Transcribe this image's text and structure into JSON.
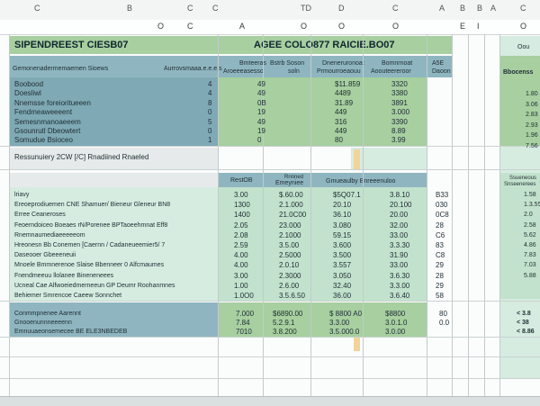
{
  "column_headers": [
    "C",
    "B",
    "C",
    "C",
    "TD",
    "D",
    "C",
    "A",
    "B",
    "B",
    "A",
    "C"
  ],
  "row2_headers": [
    "O",
    "C",
    "A",
    "O",
    "O",
    "O",
    "E",
    "I",
    "O"
  ],
  "title_left": "SIPENDREEST CIESB07",
  "title_right": "AGEE COLO877 RAICIE.BO07",
  "right_panel": {
    "small_label": "Oou",
    "header": "Bbocenss",
    "values": [
      "1.80",
      "3.06",
      "2.83",
      "2.93",
      "1.96",
      "7.56"
    ],
    "values_mid": [
      "1.58",
      "1.3.55",
      "2.0",
      "2.58",
      "5.62",
      "4.86",
      "7.83",
      "7.03",
      "5.88"
    ],
    "values_bottom": [
      "< 3.8",
      "< 38",
      "< 8.86"
    ]
  },
  "header_row": {
    "left": "Gemonenadermemaemen Sioews",
    "mid_left": "Aurrovsmaaa.e.e.e.s",
    "col1_top": "Bmteeras",
    "col1_bot": "Aroeeeasesso",
    "col2_top": "Bstrb Soson",
    "col2_bot": "soln",
    "col3_top": "Dneneruronoat",
    "col3_bot": "Prmourroeaouu",
    "col4_top": "Bomnrnoat",
    "col4_bot": "Aoouteereroor",
    "col5_top": "A5E",
    "col5_bot": "Daoon"
  },
  "top_rows": [
    {
      "label": "Boobood",
      "flag": "4",
      "c1": "49",
      "c2": "$11.859",
      "c3": "3320"
    },
    {
      "label": "Doesliwl",
      "flag": "4",
      "c1": "49",
      "c2": "4489",
      "c3": "3380"
    },
    {
      "label": "Nnemsse  foreioritueeen",
      "flag": "8",
      "c1": "0B",
      "c2": "31.89",
      "c3": "3891"
    },
    {
      "label": "Fendmeaweeeent",
      "flag": "0",
      "c1": "19",
      "c2": "449",
      "c3": "3.000"
    },
    {
      "label": "Semesnmanoaeeem",
      "flag": "5",
      "c1": "49",
      "c2": "316",
      "c3": "3390"
    },
    {
      "label": "Gsounrutl  Dbeowtert",
      "flag": "0",
      "c1": "19",
      "c2": "449",
      "c3": "8.89"
    },
    {
      "label": "Somudue  Bsioceo",
      "flag": "1",
      "c1": "0",
      "c2": "80",
      "c3": "3.99"
    }
  ],
  "note_row": "Ressunuiery  2CW  [/C]  Rnadiined  Rnaeled",
  "section2_header": {
    "c1": "RestOB",
    "c2_top": "Rnnned",
    "c2_bot": "Emeyniee",
    "c3": "Gmueaulby  Bnreeenuloo",
    "right": "Ssueneous",
    "right2": "Snseenerees"
  },
  "section2_rows": [
    {
      "label": "lriavy",
      "c1": "3.00",
      "c2": "$.60.00",
      "c3": "$5Q07.1",
      "c4": "3.8.10",
      "c5": "B33",
      "c6": "1.58"
    },
    {
      "label": "Ereoeprodiuemen  CNE  Shamuer/  Bieneur  Gleneur  BN8",
      "c1": "1300",
      "c2": "2.1.000",
      "c3": "20.10",
      "c4": "20.100",
      "c5": "030",
      "c6": "1.3.55"
    },
    {
      "label": "Erree  Ceaneroses",
      "c1": "1400",
      "c2": "21.0C00",
      "c3": "36.10",
      "c4": "20.00",
      "c5": "0C8",
      "c6": "2.0"
    },
    {
      "label": "Feoerndoiceo  Boeaes  rN/Porenee  BPTaoeehmnat  Eff8",
      "c1": "2.05",
      "c2": "23.000",
      "c3": "3.080",
      "c4": "32.00",
      "c5": "28",
      "c6": "2.58"
    },
    {
      "label": "Rnemnaumediaeeeeeom",
      "c1": "2.08",
      "c2": "2.1000",
      "c3": "59.15",
      "c4": "33.00",
      "c5": "C6",
      "c6": "5.62"
    },
    {
      "label": "Hreonesn  Bb  Conemen  [Caernn  /  Cadaneueemier5/  7",
      "c1": "2.59",
      "c2": "3.5.00",
      "c3": "3.600",
      "c4": "3.3.30",
      "c5": "83",
      "c6": "4.86"
    },
    {
      "label": "Daseooer  Gbeeeneuii",
      "c1": "4.00",
      "c2": "2.5000",
      "c3": "3.500",
      "c4": "31.90",
      "c5": "C8",
      "c6": "7.83"
    },
    {
      "label": "Mnoele  Bmmnerenoe  Slaise  Bbenneer  0  Alfcmaumes",
      "c1": "4.00",
      "c2": "2.0.10",
      "c3": "3.557",
      "c4": "33.00",
      "c5": "29",
      "c6": "7.03"
    },
    {
      "label": "Fnendmeeuu  llolanee   Bineneneees",
      "c1": "3.00",
      "c2": "2.3000",
      "c3": "3.050",
      "c4": "3.6.30",
      "c5": "28",
      "c6": "5.88"
    },
    {
      "label": "Ucneal  Cae  Alfwoeiedmerneeun  GP  Deumr  Roohanmnes",
      "c1": "1.00",
      "c2": "2.6.00",
      "c3": "32.40",
      "c4": "3.3.00",
      "c5": "29",
      "c6": ""
    },
    {
      "label": "Behiemer  Smrencoe  Caeew  Sonnchet",
      "c1": "1.0O0",
      "c2": "3.5.6.50",
      "c3": "36.00",
      "c4": "3.6.40",
      "c5": "58",
      "c6": ""
    }
  ],
  "summary_rows": [
    {
      "label": "Conmmpnenee  Aarennt",
      "c1": "7.000",
      "c2": "$6890.00",
      "c3": "$ 8800 A0",
      "c4": "$8800",
      "c5": "80",
      "c6": "< 3.8"
    },
    {
      "label": "Gnooenunnneeeenn",
      "c1": "7.84",
      "c2": "5.2.9.1",
      "c3": "3.3.00",
      "c4": "3.0.1.0",
      "c5": "0.0",
      "c6": "< 38"
    },
    {
      "label": "Emnuuaeonsemecee  BE  ELE3NBEDEB",
      "c1": "7010",
      "c2": "3.8.200",
      "c3": "3.5.000.0",
      "c4": "3.0.00",
      "c5": "",
      "c6": "< 8.86"
    }
  ]
}
